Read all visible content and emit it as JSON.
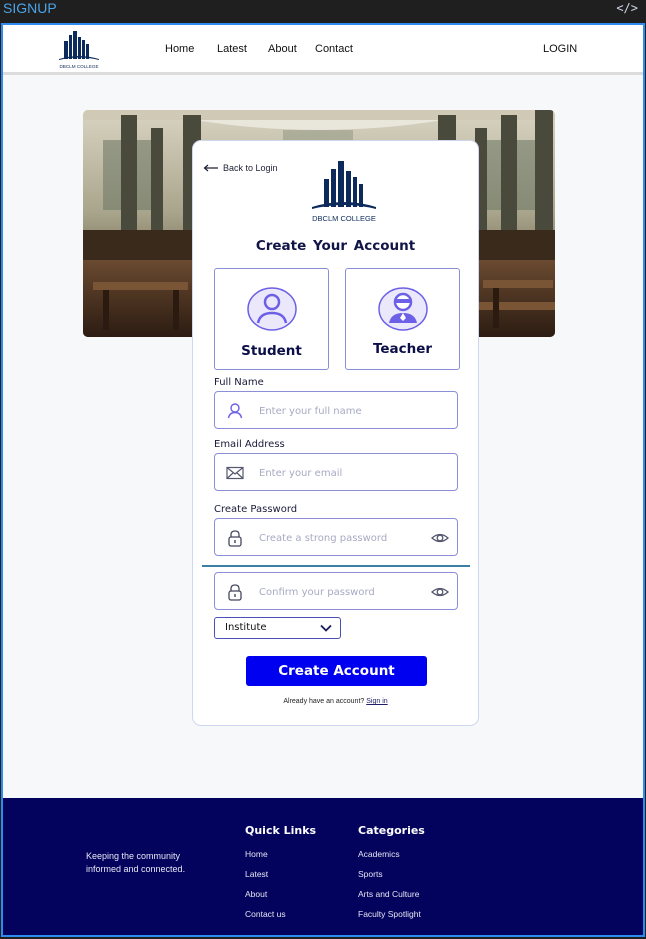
{
  "frame": {
    "label": "SIGNUP",
    "code_icon": "</>"
  },
  "header": {
    "logo_text": "DBCLM COLLEGE",
    "nav": [
      "Home",
      "Latest",
      "About",
      "Contact"
    ],
    "login": "LOGIN"
  },
  "card": {
    "back": "Back to Login",
    "logo_text": "DBCLM COLLEGE",
    "title": "Create  Your Account",
    "roles": {
      "student": "Student",
      "teacher": "Teacher"
    },
    "full_name": {
      "label": "Full Name",
      "placeholder": "Enter your full name"
    },
    "email": {
      "label": "Email Address",
      "placeholder": "Enter your email"
    },
    "password": {
      "label": "Create Password",
      "placeholder": "Create a strong password"
    },
    "confirm": {
      "placeholder": "Confirm your password"
    },
    "select": {
      "value": "Institute"
    },
    "submit": "Create Account",
    "signin_prompt": "Already have an account?",
    "signin_link": "Sign in"
  },
  "footer": {
    "tagline": "Keeping the community informed and connected.",
    "quick_links": {
      "title": "Quick Links",
      "items": [
        "Home",
        "Latest",
        "About",
        "Contact us"
      ]
    },
    "categories": {
      "title": "Categories",
      "items": [
        "Academics",
        "Sports",
        "Arts and Culture",
        "Faculty Spotlight"
      ]
    }
  },
  "colors": {
    "primary": "#0000f0",
    "footer": "#03035e",
    "accent": "#7b6df0",
    "frame": "#2d8bf0"
  }
}
